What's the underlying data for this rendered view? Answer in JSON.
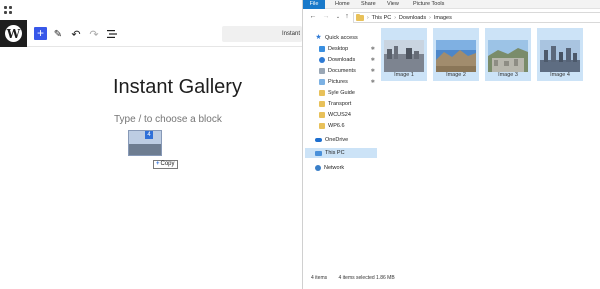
{
  "editor": {
    "title_bar_text": "Instant",
    "post_title": "Instant Gallery",
    "block_placeholder": "Type / to choose a block",
    "drag_count": "4",
    "drag_hint": "Copy"
  },
  "explorer": {
    "ribbon_tabs": [
      "File",
      "Home",
      "Share",
      "View",
      "Picture Tools"
    ],
    "breadcrumb": [
      "This PC",
      "Downloads",
      "Images"
    ],
    "sidebar": [
      {
        "label": "Quick access",
        "icon": "star-icon"
      },
      {
        "label": "Desktop",
        "icon": "desktop-icon",
        "pinned": true
      },
      {
        "label": "Downloads",
        "icon": "downloads-icon",
        "pinned": true
      },
      {
        "label": "Documents",
        "icon": "documents-icon",
        "pinned": true
      },
      {
        "label": "Pictures",
        "icon": "pictures-icon",
        "pinned": true
      },
      {
        "label": "Syle Guide",
        "icon": "folder-icon"
      },
      {
        "label": "Transport",
        "icon": "folder-icon"
      },
      {
        "label": "WCUS24",
        "icon": "folder-icon"
      },
      {
        "label": "WP6.6",
        "icon": "folder-icon"
      },
      {
        "label": "OneDrive",
        "icon": "onedrive-icon"
      },
      {
        "label": "This PC",
        "icon": "this-pc-icon",
        "selected": true
      },
      {
        "label": "Network",
        "icon": "network-icon"
      }
    ],
    "files": [
      {
        "label": "Image 1",
        "selected": true
      },
      {
        "label": "Image 2",
        "selected": true
      },
      {
        "label": "Image 3",
        "selected": true
      },
      {
        "label": "Image 4",
        "selected": true
      }
    ],
    "status": {
      "count": "4 items",
      "selection": "4 items selected 1.86 MB"
    }
  },
  "colors": {
    "wp_blue": "#3858e9",
    "explorer_file_tab": "#1979ca",
    "selection": "#cce3f7"
  }
}
